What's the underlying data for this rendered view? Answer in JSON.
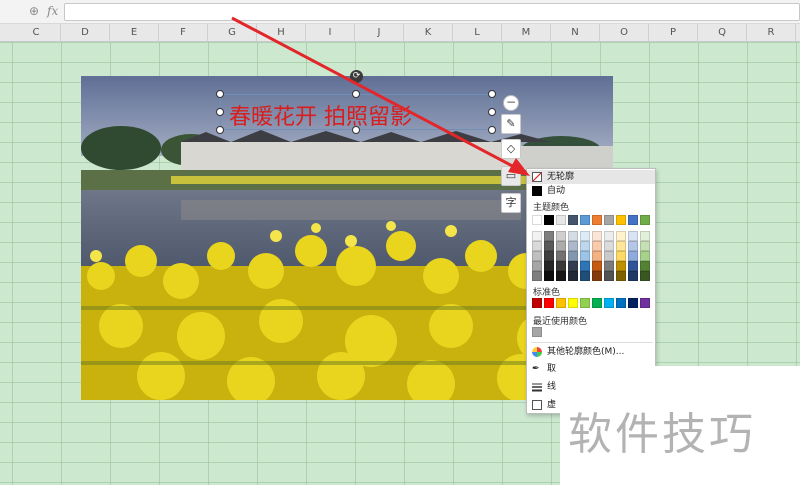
{
  "formula_bar": {
    "zoom_icon": "zoom-icon",
    "fx_label": "fx",
    "value": ""
  },
  "columns": [
    "C",
    "D",
    "E",
    "F",
    "G",
    "H",
    "I",
    "J",
    "K",
    "L",
    "M",
    "N",
    "O",
    "P",
    "Q",
    "R"
  ],
  "textbox": {
    "text": "春暖花开  拍照留影",
    "color": "#d81e1e"
  },
  "side_toolbar": [
    "minus-icon",
    "pen-icon",
    "fill-icon",
    "outline-icon",
    "text-icon"
  ],
  "side_toolbar_text": "字",
  "outline_menu": {
    "no_outline": "无轮廓",
    "auto": "自动",
    "theme_colors_label": "主题颜色",
    "standard_colors_label": "标准色",
    "recent_colors_label": "最近使用颜色",
    "more_colors": "其他轮廓颜色(M)...",
    "eyedropper": "取",
    "line_type": "线",
    "dash_type": "虚",
    "theme_top_row": [
      "#ffffff",
      "#000000",
      "#e7e6e6",
      "#44546a",
      "#5b9bd5",
      "#ed7d31",
      "#a5a5a5",
      "#ffc000",
      "#4472c4",
      "#70ad47"
    ],
    "theme_shades": [
      [
        "#f2f2f2",
        "#7f7f7f",
        "#d0cece",
        "#d6dce5",
        "#deebf7",
        "#fbe5d6",
        "#ededed",
        "#fff2cc",
        "#dae3f3",
        "#e2f0d9"
      ],
      [
        "#d9d9d9",
        "#595959",
        "#aeabab",
        "#adb9ca",
        "#bdd7ee",
        "#f8cbad",
        "#dbdbdb",
        "#ffe699",
        "#b4c7e7",
        "#c5e0b4"
      ],
      [
        "#bfbfbf",
        "#404040",
        "#757171",
        "#8497b0",
        "#9dc3e6",
        "#f4b183",
        "#c9c9c9",
        "#ffd966",
        "#8faadc",
        "#a9d18e"
      ],
      [
        "#a6a6a6",
        "#262626",
        "#3b3838",
        "#333f50",
        "#2e75b6",
        "#c55a11",
        "#7b7b7b",
        "#bf9000",
        "#2f5597",
        "#548235"
      ],
      [
        "#7f7f7f",
        "#0d0d0d",
        "#171515",
        "#222a35",
        "#1f4e79",
        "#843c0c",
        "#525252",
        "#7f6000",
        "#203864",
        "#385723"
      ]
    ],
    "standard_colors": [
      "#c00000",
      "#ff0000",
      "#ffc000",
      "#ffff00",
      "#92d050",
      "#00b050",
      "#00b0f0",
      "#0070c0",
      "#002060",
      "#7030a0"
    ],
    "recent_colors": [
      "#a6a6a6"
    ]
  },
  "watermark": {
    "text": "软件技巧"
  }
}
